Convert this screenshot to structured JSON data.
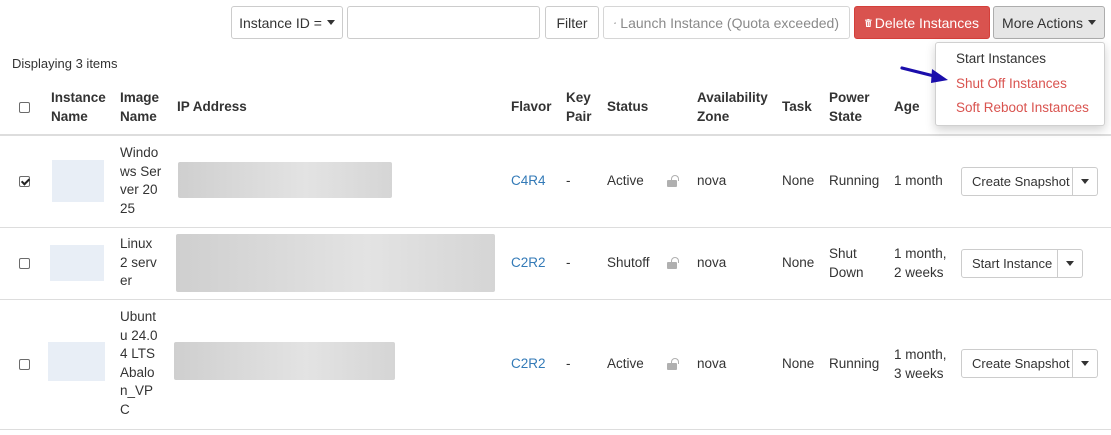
{
  "toolbar": {
    "filter_field_label": "Instance ID =",
    "filter_input_value": "",
    "filter_button_label": "Filter",
    "launch_button_label": "Launch Instance (Quota exceeded)",
    "delete_button_label": "Delete Instances",
    "more_actions_label": "More Actions"
  },
  "more_actions_menu": [
    {
      "label": "Start Instances"
    },
    {
      "label": "Shut Off Instances"
    },
    {
      "label": "Soft Reboot Instances"
    }
  ],
  "summary": {
    "displaying": "Displaying 3 items"
  },
  "table": {
    "headers": {
      "instance_name": [
        "Instance",
        "Name"
      ],
      "image_name": [
        "Image",
        "Name"
      ],
      "ip_address": "IP Address",
      "flavor": "Flavor",
      "key_pair": [
        "Key",
        "Pair"
      ],
      "status": "Status",
      "availability_zone": [
        "Availability",
        "Zone"
      ],
      "task": "Task",
      "power_state": [
        "Power",
        "State"
      ],
      "age": "Age"
    },
    "rows": [
      {
        "checked": true,
        "image_lines": [
          "Windo",
          "ws Ser",
          "ver 20",
          "25"
        ],
        "flavor": "C4R4",
        "key_pair": "-",
        "status": "Active",
        "zone": "nova",
        "task": "None",
        "power_lines": [
          "Running"
        ],
        "age_lines": [
          "1 month"
        ],
        "action_label": "Create Snapshot"
      },
      {
        "checked": false,
        "image_lines": [
          "Linux",
          "2 serv",
          "er"
        ],
        "flavor": "C2R2",
        "key_pair": "-",
        "status": "Shutoff",
        "zone": "nova",
        "task": "None",
        "power_lines": [
          "Shut",
          "Down"
        ],
        "age_lines": [
          "1 month,",
          "2 weeks"
        ],
        "action_label": "Start Instance"
      },
      {
        "checked": false,
        "image_lines": [
          "Ubunt",
          "u 24.0",
          "4 LTS",
          "Abalo",
          "n_VP",
          "C"
        ],
        "flavor": "C2R2",
        "key_pair": "-",
        "status": "Active",
        "zone": "nova",
        "task": "None",
        "power_lines": [
          "Running"
        ],
        "age_lines": [
          "1 month,",
          "3 weeks"
        ],
        "action_label": "Create Snapshot"
      }
    ]
  },
  "icons": {
    "caret": "chevron-down-icon",
    "launch": "cloud-upload-icon",
    "delete": "trash-icon",
    "lock": "lock-icon",
    "annotation": "arrow-icon"
  },
  "colors": {
    "danger": "#d9534f",
    "link": "#337ab7",
    "annotation_arrow": "#1a0dab"
  }
}
